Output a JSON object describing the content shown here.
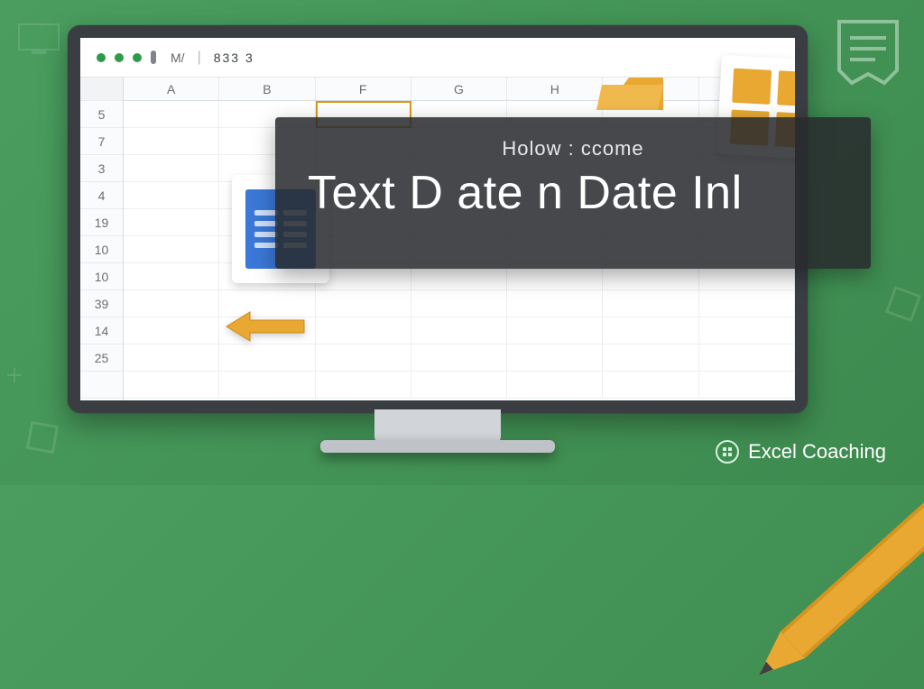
{
  "toolbar": {
    "m_label": "M/",
    "num_text": "833  3"
  },
  "spreadsheet": {
    "columns": [
      "A",
      "B",
      "F",
      "G",
      "H",
      "",
      ""
    ],
    "rows": [
      "5",
      "7",
      "3",
      "4",
      "19",
      "10",
      "10",
      "39",
      "14",
      "25",
      ""
    ]
  },
  "overlay": {
    "small_text": "Holow : ccome",
    "big_text": "Text D ate n Date Inl"
  },
  "brand": {
    "name": "Excel Coaching"
  }
}
